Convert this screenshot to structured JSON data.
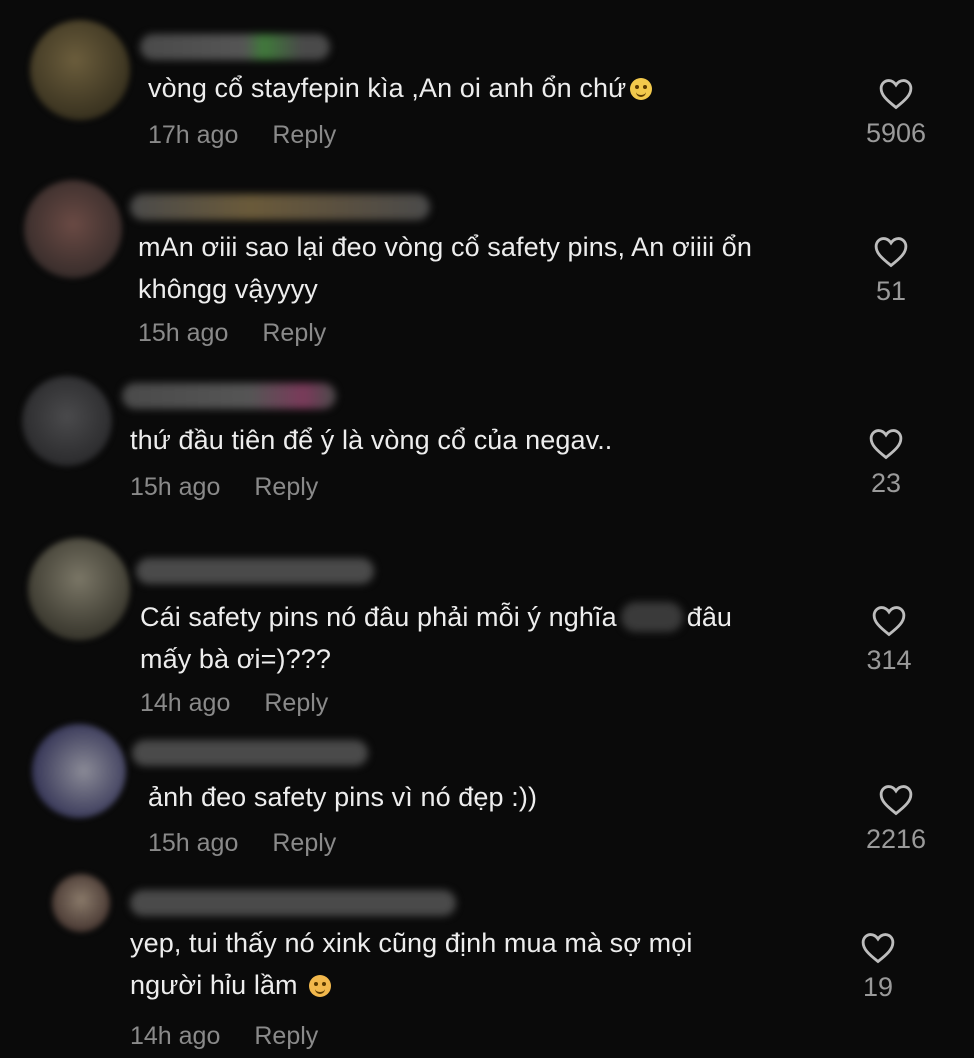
{
  "comments": [
    {
      "text_lines": [
        "vòng cổ stayfepin kìa ,An oi anh ổn chứ"
      ],
      "emoji": "pleading-face-emoji",
      "time": "17h ago",
      "reply": "Reply",
      "likes": "5906"
    },
    {
      "text_lines": [
        "mAn ơiii sao lại đeo vòng cổ safety pins, An ơiiii ổn",
        "khôngg vậyyyy"
      ],
      "time": "15h ago",
      "reply": "Reply",
      "likes": "51"
    },
    {
      "text_lines": [
        "thứ đầu tiên để ý là vòng cổ của negav.."
      ],
      "time": "15h ago",
      "reply": "Reply",
      "likes": "23"
    },
    {
      "text_before_blur": "Cái safety pins nó đâu phải mỗi ý nghĩa",
      "text_after_blur": "đâu",
      "text_line2": "mấy bà ơi=)???",
      "time": "14h ago",
      "reply": "Reply",
      "likes": "314"
    },
    {
      "text_lines": [
        "ảnh đeo safety pins vì nó đẹp :))"
      ],
      "time": "15h ago",
      "reply": "Reply",
      "likes": "2216"
    },
    {
      "text_lines": [
        "yep, tui thấy nó xink cũng định mua mà sợ mọi",
        "người hỉu lầm"
      ],
      "emoji": "upside-down-face-emoji",
      "time": "14h ago",
      "reply": "Reply",
      "likes": "19"
    }
  ],
  "colors": {
    "background": "#0a0a0a",
    "text": "#ededed",
    "meta": "#8a8a8a",
    "heart": "#bdbdbd"
  },
  "icons": {
    "like": "heart-outline-icon"
  }
}
